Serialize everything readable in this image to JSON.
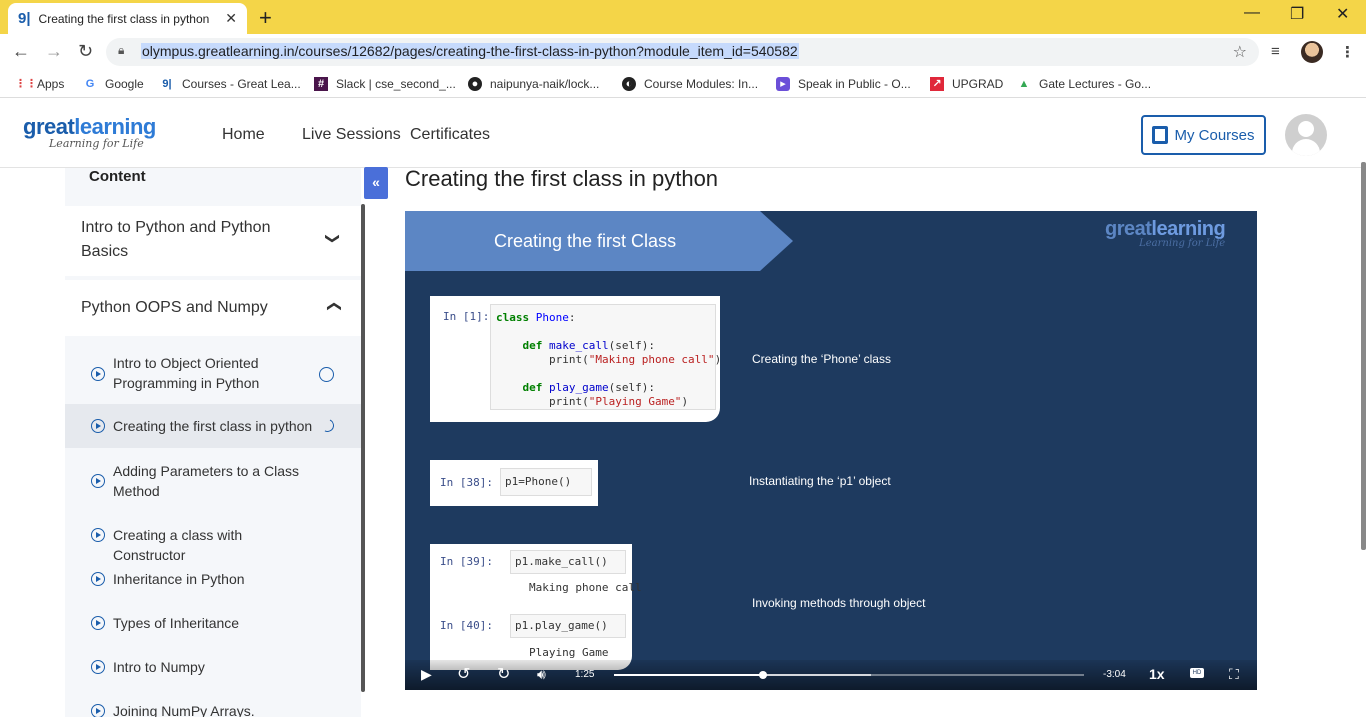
{
  "browser": {
    "tab_title": "Creating the first class in python",
    "tab_favicon": "gl",
    "url": "olympus.greatlearning.in/courses/12682/pages/creating-the-first-class-in-python?module_item_id=540582",
    "bookmarks": [
      {
        "label": "Apps",
        "icon": "apps-grid-icon"
      },
      {
        "label": "Google",
        "icon": "google-icon"
      },
      {
        "label": "Courses - Great Lea...",
        "icon": "gl-icon"
      },
      {
        "label": "Slack | cse_second_...",
        "icon": "slack-icon"
      },
      {
        "label": "naipunya-naik/lock...",
        "icon": "github-icon"
      },
      {
        "label": "Course Modules: In...",
        "icon": "course-icon"
      },
      {
        "label": "Speak in Public - O...",
        "icon": "speak-icon"
      },
      {
        "label": "UPGRAD",
        "icon": "upgrad-icon"
      },
      {
        "label": "Gate Lectures - Go...",
        "icon": "drive-icon"
      }
    ]
  },
  "header": {
    "logo_main_a": "great",
    "logo_main_b": "learning",
    "logo_tagline": "Learning for Life",
    "nav": [
      "Home",
      "Live Sessions",
      "Certificates"
    ],
    "my_courses": "My Courses"
  },
  "sidebar": {
    "title": "Content",
    "sections": [
      {
        "label": "Intro to Python and Python Basics",
        "expanded": false
      },
      {
        "label": "Python OOPS and Numpy",
        "expanded": true
      }
    ],
    "items": [
      {
        "label": "Intro to Object Oriented Programming in Python",
        "status": "not-started"
      },
      {
        "label": "Creating the first class in python",
        "status": "in-progress",
        "active": true
      },
      {
        "label": "Adding Parameters to a Class Method"
      },
      {
        "label": "Creating a class with Constructor"
      },
      {
        "label": "Inheritance in Python"
      },
      {
        "label": "Types of Inheritance"
      },
      {
        "label": "Intro to Numpy"
      },
      {
        "label": "Joining NumPy Arrays."
      }
    ]
  },
  "main": {
    "title": "Creating the first class in python",
    "video": {
      "banner": "Creating the first Class",
      "logo_a": "great",
      "logo_b": "learning",
      "logo_tagline": "Learning for Life",
      "cell1_prompt": "In [1]:",
      "cell2_prompt": "In [38]:",
      "cell2_code": "p1=Phone()",
      "cell3_prompt": "In [39]:",
      "cell3_code": "p1.make_call()",
      "cell3_output": "Making phone call",
      "cell4_prompt": "In [40]:",
      "cell4_code": "p1.play_game()",
      "cell4_output": "Playing Game",
      "caption1": "Creating the ‘Phone’ class",
      "caption2": "Instantiating the ‘p1’ object",
      "caption3": "Invoking methods through object",
      "current_time": "1:25",
      "remaining_time": "-3:04",
      "speed": "1x",
      "progress": 0.316,
      "buffered": 0.547
    }
  }
}
